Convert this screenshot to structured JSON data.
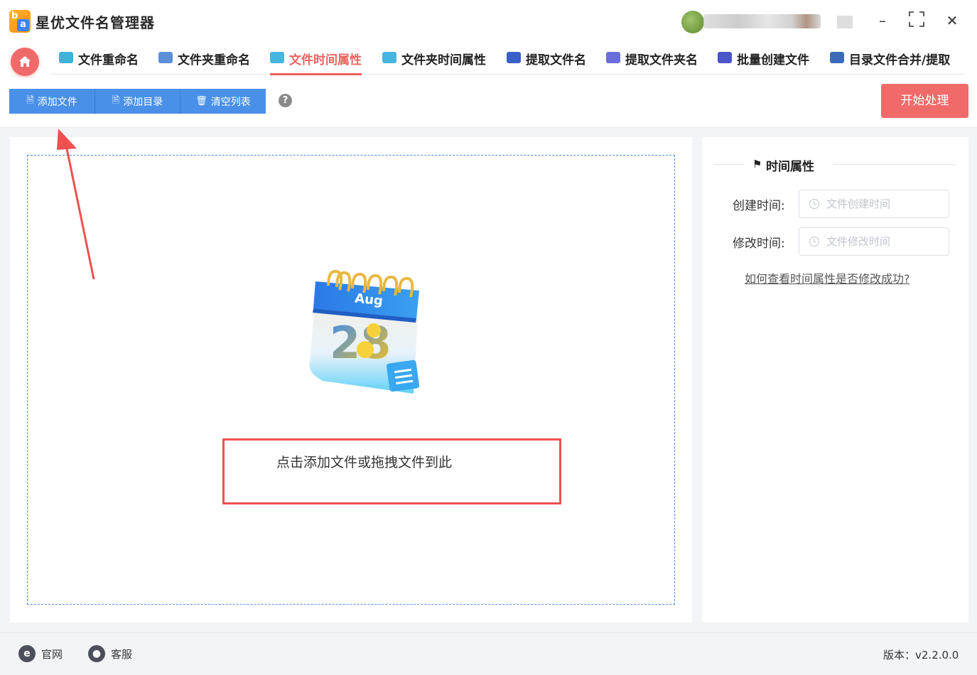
{
  "app": {
    "title": "星优文件名管理器"
  },
  "window": {
    "minimize": "–",
    "maximize": "⛶",
    "close": "✕"
  },
  "nav": {
    "tabs": [
      {
        "label": "文件重命名",
        "icon": "file-rename-icon",
        "color": "#3bb4d8"
      },
      {
        "label": "文件夹重命名",
        "icon": "folder-rename-icon",
        "color": "#5b8fd8"
      },
      {
        "label": "文件时间属性",
        "icon": "file-time-icon",
        "color": "#46b5e0",
        "active": true
      },
      {
        "label": "文件夹时间属性",
        "icon": "folder-time-icon",
        "color": "#46b5e0"
      },
      {
        "label": "提取文件名",
        "icon": "extract-filename-icon",
        "color": "#3a5fc8"
      },
      {
        "label": "提取文件夹名",
        "icon": "extract-foldername-icon",
        "color": "#6a6ed8"
      },
      {
        "label": "批量创建文件",
        "icon": "batch-create-icon",
        "color": "#4a55c8"
      },
      {
        "label": "目录文件合并/提取",
        "icon": "merge-extract-icon",
        "color": "#3a6ab8"
      }
    ]
  },
  "toolbar": {
    "add_file": "添加文件",
    "add_dir": "添加目录",
    "clear_list": "清空列表",
    "help": "?",
    "start": "开始处理"
  },
  "main": {
    "calendar_month": "Aug",
    "calendar_day": "28",
    "drop_hint": "点击添加文件或拖拽文件到此"
  },
  "right": {
    "title": "时间属性",
    "create_label": "创建时间:",
    "create_placeholder": "文件创建时间",
    "modify_label": "修改时间:",
    "modify_placeholder": "文件修改时间",
    "help_link": "如何查看时间属性是否修改成功?"
  },
  "footer": {
    "website": "官网",
    "support": "客服",
    "version": "版本：v2.2.0.0"
  },
  "colors": {
    "accent": "#4a90e8",
    "primary_red": "#f06a6a"
  }
}
